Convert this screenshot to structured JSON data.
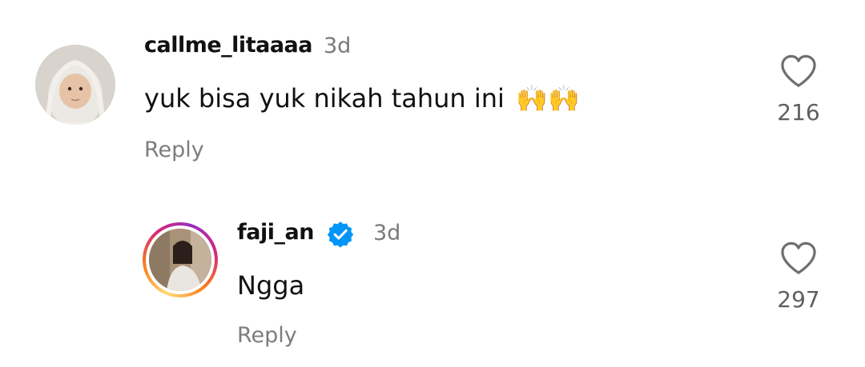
{
  "comments": [
    {
      "username": "callme_litaaaa",
      "time": "3d",
      "text": "yuk bisa yuk nikah tahun ini",
      "emoji": "🙌🙌",
      "reply_label": "Reply",
      "likes": "216",
      "avatar_icon": "user-avatar-icon",
      "verified": false,
      "story_ring": false
    },
    {
      "username": "faji_an",
      "time": "3d",
      "text": "Ngga",
      "reply_label": "Reply",
      "likes": "297",
      "avatar_icon": "user-avatar-icon",
      "verified": true,
      "story_ring": true
    }
  ],
  "colors": {
    "verified_badge": "#0095f6",
    "text_primary": "#111111",
    "text_secondary": "#7d7d7d",
    "story_ring_start": "#feda75",
    "story_ring_end": "#d62976"
  }
}
